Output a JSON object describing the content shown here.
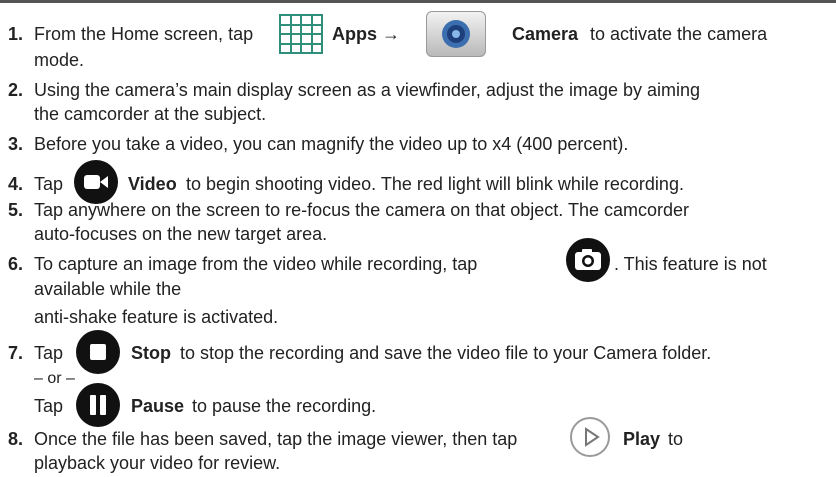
{
  "steps": [
    {
      "num": "1.",
      "a": "From the Home screen, tap",
      "apps": "Apps →",
      "camera": "Camera",
      "b": "to activate the camera",
      "c": "mode."
    },
    {
      "num": "2.",
      "a": "Using the camera’s main display screen as a viewfinder, adjust the image by aiming",
      "b": "the camcorder at the subject."
    },
    {
      "num": "3.",
      "a": "Before you take a video, you can magnify the video up to x4 (400 percent)."
    },
    {
      "num": "4.",
      "a": "Tap",
      "bold": "Video",
      "b": "to begin shooting video. The red light will blink while recording."
    },
    {
      "num": "5.",
      "a": "Tap anywhere on the screen to re-focus the camera on that object. The camcorder",
      "b": "auto-focuses on the new target area."
    },
    {
      "num": "6.",
      "a": "To capture an image from the video while recording, tap",
      "b": ". This feature is not",
      "c": "available while the",
      "d": "anti-shake feature is activated."
    },
    {
      "num": "7.",
      "a": "Tap",
      "bold": "Stop",
      "b": "to stop the recording and save the video file to your Camera folder.",
      "or": "– or –",
      "c": "Tap",
      "bold2": "Pause",
      "d": "to pause the recording."
    },
    {
      "num": "8.",
      "a": "Once the file has been saved, tap the image viewer, then tap",
      "bold": "Play",
      "b": "to",
      "c": "playback your video for review."
    }
  ],
  "icons": [
    "apps-grid-icon",
    "camera-app-icon",
    "video-record-icon",
    "camera-capture-icon",
    "stop-icon",
    "pause-icon",
    "play-icon"
  ]
}
